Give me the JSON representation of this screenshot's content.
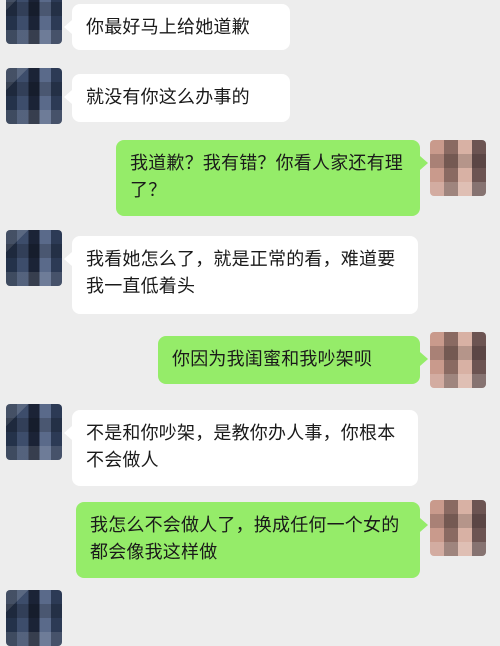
{
  "messages": [
    {
      "side": "left",
      "text": "你最好马上给她道歉"
    },
    {
      "side": "left",
      "text": "就没有你这么办事的"
    },
    {
      "side": "right",
      "text": "我道歉？我有错？你看人家还有理了？"
    },
    {
      "side": "left",
      "text": "我看她怎么了，就是正常的看，难道要我一直低着头"
    },
    {
      "side": "right",
      "text": "你因为我闺蜜和我吵架呗"
    },
    {
      "side": "left",
      "text": "不是和你吵架，是教你办人事，你根本不会做人"
    },
    {
      "side": "right",
      "text": "我怎么不会做人了，换成任何一个女的都会像我这样做"
    }
  ]
}
